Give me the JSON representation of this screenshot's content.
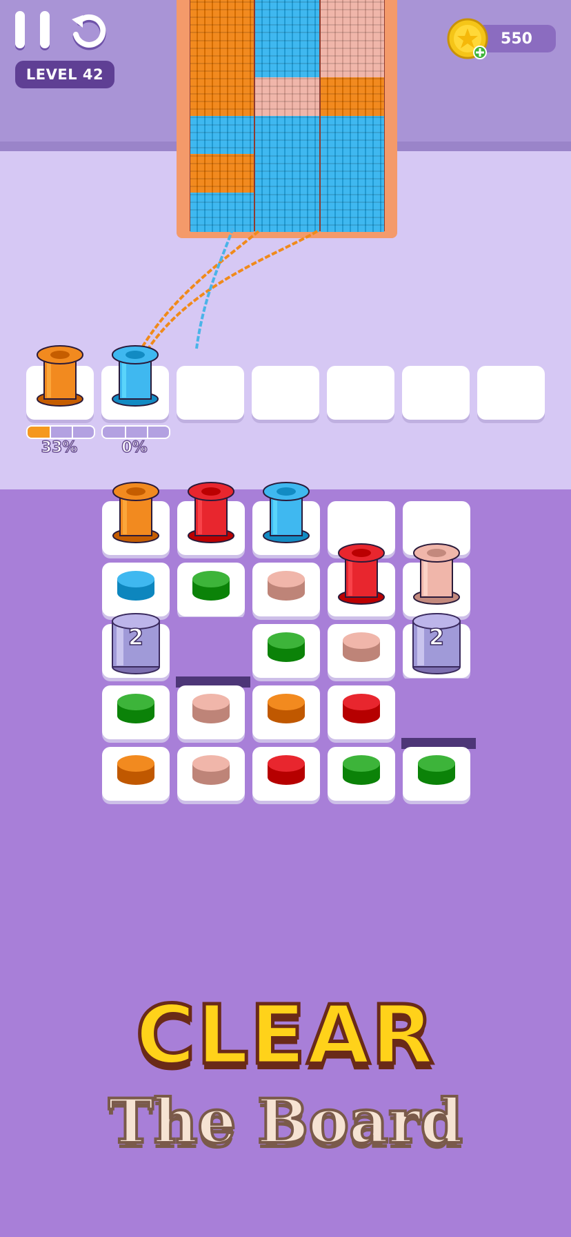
{
  "hud": {
    "level_label": "LEVEL 42",
    "coins": "550",
    "pause_icon": "pause-icon",
    "undo_icon": "undo-icon",
    "coin_icon": "coin-star-icon"
  },
  "fabric": {
    "columns": [
      [
        "orange",
        "orange",
        "orange",
        "blue",
        "orange",
        "blue"
      ],
      [
        "blue",
        "blue",
        "pink",
        "blue",
        "blue",
        "blue"
      ],
      [
        "pink",
        "pink",
        "orange",
        "blue",
        "blue",
        "blue"
      ]
    ]
  },
  "holding_slots": [
    {
      "spool": "orange",
      "progress": 0.33,
      "progress_label": "33%"
    },
    {
      "spool": "blue",
      "progress": 0,
      "progress_label": "0%"
    },
    {
      "spool": null
    },
    {
      "spool": null
    },
    {
      "spool": null
    },
    {
      "spool": null
    },
    {
      "spool": null
    }
  ],
  "board": {
    "rows": [
      [
        "spool-orange",
        "spool-red",
        "spool-blue",
        "empty",
        "empty"
      ],
      [
        "peg-blue",
        "peg-green",
        "peg-pink",
        "spool-red",
        "spool-pink"
      ],
      [
        "lock-2",
        "hole",
        "peg-green",
        "peg-pink",
        "lock-2"
      ],
      [
        "peg-green",
        "peg-pink",
        "peg-orange",
        "peg-red",
        "hole"
      ],
      [
        "peg-orange",
        "peg-pink",
        "peg-red",
        "peg-green",
        "peg-green"
      ]
    ],
    "lock_count": "2"
  },
  "headline": {
    "title": "CLEAR",
    "subtitle": "The Board"
  },
  "colors": {
    "orange": "#f28a1f",
    "blue": "#3fb8f0",
    "pink": "#f0b6aa",
    "red": "#e8262e",
    "green": "#3db43a",
    "purple_bg": "#a87fd8",
    "lavender": "#d6c8f4"
  }
}
